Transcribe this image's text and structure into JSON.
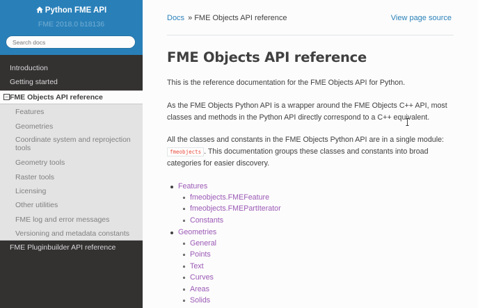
{
  "sidebar": {
    "project_title": "Python FME API",
    "version": "FME 2018.0 b18136",
    "search_placeholder": "Search docs",
    "nav": {
      "introduction": "Introduction",
      "getting_started": "Getting started",
      "current": "FME Objects API reference",
      "current_toggle": "−",
      "sub_items": [
        "Features",
        "Geometries",
        "Coordinate system and reprojection tools",
        "Geometry tools",
        "Raster tools",
        "Licensing",
        "Other utilities",
        "FME log and error messages",
        "Versioning and metadata constants"
      ],
      "pluginbuilder": "FME Pluginbuilder API reference"
    }
  },
  "breadcrumb": {
    "docs": "Docs",
    "separator": "»",
    "current": "FME Objects API reference"
  },
  "view_source": "View page source",
  "page": {
    "title": "FME Objects API reference",
    "para1": "This is the reference documentation for the FME Objects API for Python.",
    "para2": "As the FME Objects Python API is a wrapper around the FME Objects C++ API, most classes and methods in the Python API directly correspond to a C++ equivalent.",
    "para3_before": "All the classes and constants in the FME Objects Python API are in a single module: ",
    "para3_code": "fmeobjects",
    "para3_after": ". This documentation groups these classes and constants into broad categories for easier discovery."
  },
  "toc": [
    {
      "label": "Features",
      "children": [
        "fmeobjects.FMEFeature",
        "fmeobjects.FMEPartIterator",
        "Constants"
      ]
    },
    {
      "label": "Geometries",
      "children": [
        "General",
        "Points",
        "Text",
        "Curves",
        "Areas",
        "Solids"
      ]
    }
  ],
  "colors": {
    "sidebar_bg": "#343131",
    "sidebar_header": "#2980b9",
    "link": "#2980b9",
    "visited_link": "#9b59b6",
    "text": "#404040"
  }
}
